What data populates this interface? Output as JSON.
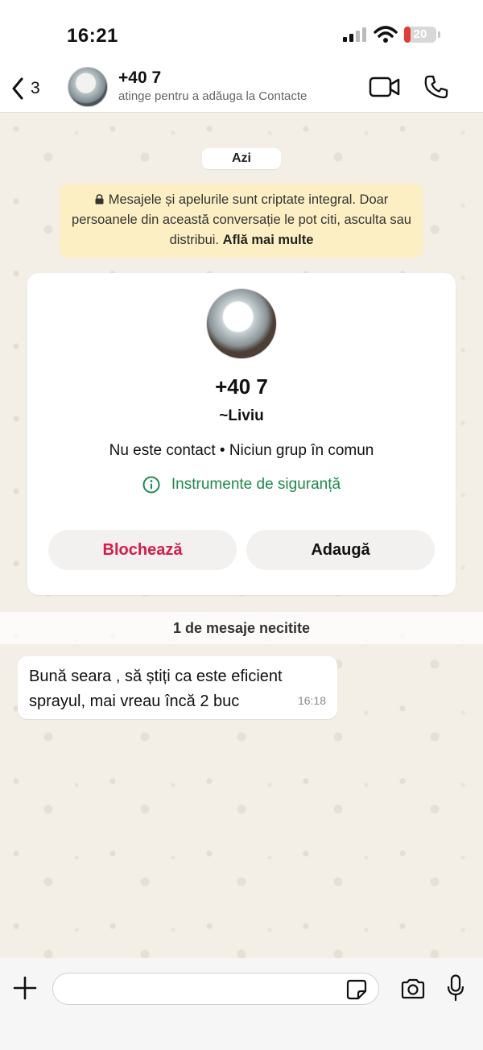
{
  "status_bar": {
    "time": "16:21",
    "battery_level": "20",
    "battery_fraction": 0.2,
    "battery_color": "#e53935"
  },
  "header": {
    "back_count": "3",
    "contact_name": "+40 7",
    "contact_subtitle": "atinge pentru a adăuga la Contacte",
    "icons": [
      "back-chevron-icon",
      "video-call-icon",
      "phone-icon"
    ]
  },
  "chat": {
    "day_label": "Azi",
    "encryption_text": "Mesajele și apelurile sunt criptate integral. Doar persoanele din această conversație le pot citi, asculta sau distribui.",
    "encryption_link": "Află mai multe",
    "contact_card": {
      "number": "+40 7",
      "alias": "~Liviu",
      "info": "Nu este contact • Niciun grup în comun",
      "safety_tools": "Instrumente de siguranță",
      "block_label": "Blochează",
      "add_label": "Adaugă",
      "block_color": "#d81b49",
      "safety_color": "#1b8b4c"
    },
    "unread_label": "1 de mesaje necitite",
    "messages": [
      {
        "line1": "Bună seara , să știți ca este eficient",
        "line2": "sprayul, mai vreau încă 2 buc",
        "time": "16:18"
      }
    ]
  },
  "composer": {
    "placeholder": "",
    "icons": [
      "plus-icon",
      "sticker-icon",
      "camera-icon",
      "microphone-icon"
    ]
  }
}
